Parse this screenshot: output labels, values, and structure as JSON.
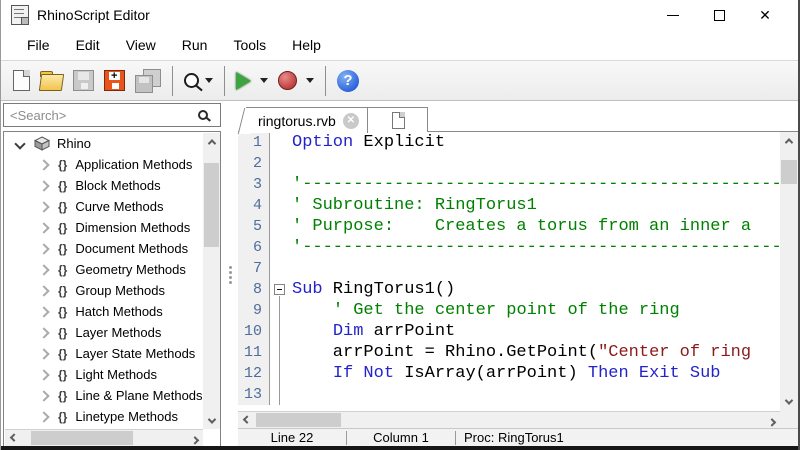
{
  "window": {
    "title": "RhinoScript Editor"
  },
  "menu_bar": {
    "items": [
      "File",
      "Edit",
      "View",
      "Run",
      "Tools",
      "Help"
    ]
  },
  "toolbar": {
    "buttons": [
      "new-file",
      "open-file",
      "save",
      "save-incremental",
      "save-all",
      "search",
      "run-script",
      "break-script",
      "help"
    ]
  },
  "sidebar": {
    "search_placeholder": "<Search>",
    "tree": {
      "root_label": "Rhino",
      "items": [
        "Application Methods",
        "Block Methods",
        "Curve Methods",
        "Dimension Methods",
        "Document Methods",
        "Geometry Methods",
        "Group Methods",
        "Hatch Methods",
        "Layer Methods",
        "Layer State Methods",
        "Light Methods",
        "Line & Plane Methods",
        "Linetype Methods"
      ]
    }
  },
  "editor": {
    "tabs": [
      {
        "label": "ringtorus.rvb"
      },
      {
        "label": ""
      }
    ],
    "lines": [
      {
        "num": "1",
        "fold": "",
        "tokens": [
          {
            "c": "kw",
            "t": "Option"
          },
          {
            "c": "pl",
            "t": " Explicit"
          }
        ]
      },
      {
        "num": "2",
        "fold": "",
        "tokens": []
      },
      {
        "num": "3",
        "fold": "",
        "tokens": [
          {
            "c": "cm",
            "t": "'------------------------------------------------------------"
          }
        ]
      },
      {
        "num": "4",
        "fold": "",
        "tokens": [
          {
            "c": "cm",
            "t": "' Subroutine: RingTorus1"
          }
        ]
      },
      {
        "num": "5",
        "fold": "",
        "tokens": [
          {
            "c": "cm",
            "t": "' Purpose:    Creates a torus from an inner a"
          }
        ]
      },
      {
        "num": "6",
        "fold": "",
        "tokens": [
          {
            "c": "cm",
            "t": "'------------------------------------------------------------"
          }
        ]
      },
      {
        "num": "7",
        "fold": "",
        "tokens": []
      },
      {
        "num": "8",
        "fold": "minus",
        "tokens": [
          {
            "c": "kw",
            "t": "Sub"
          },
          {
            "c": "pl",
            "t": " RingTorus1()"
          }
        ]
      },
      {
        "num": "9",
        "fold": "line",
        "tokens": [
          {
            "c": "pl",
            "t": "    "
          },
          {
            "c": "cm",
            "t": "' Get the center point of the ring"
          }
        ]
      },
      {
        "num": "10",
        "fold": "line",
        "tokens": [
          {
            "c": "pl",
            "t": "    "
          },
          {
            "c": "kw",
            "t": "Dim"
          },
          {
            "c": "pl",
            "t": " arrPoint"
          }
        ]
      },
      {
        "num": "11",
        "fold": "line",
        "tokens": [
          {
            "c": "pl",
            "t": "    arrPoint = Rhino.GetPoint("
          },
          {
            "c": "str",
            "t": "\"Center of ring"
          }
        ]
      },
      {
        "num": "12",
        "fold": "line",
        "tokens": [
          {
            "c": "pl",
            "t": "    "
          },
          {
            "c": "kw",
            "t": "If"
          },
          {
            "c": "pl",
            "t": " "
          },
          {
            "c": "kw",
            "t": "Not"
          },
          {
            "c": "pl",
            "t": " IsArray(arrPoint) "
          },
          {
            "c": "kw",
            "t": "Then"
          },
          {
            "c": "pl",
            "t": " "
          },
          {
            "c": "kw",
            "t": "Exit"
          },
          {
            "c": "pl",
            "t": " "
          },
          {
            "c": "kw",
            "t": "Sub"
          }
        ]
      },
      {
        "num": "13",
        "fold": "line",
        "tokens": []
      }
    ]
  },
  "status_bar": {
    "line": "Line 22",
    "column": "Column 1",
    "proc": "Proc: RingTorus1"
  },
  "colors": {
    "keyword": "#2323cc",
    "comment": "#008000",
    "string": "#8b1a1a",
    "line_number": "#4e6d9c",
    "folder": "#f2c44d",
    "run": "#3fa33f",
    "record": "#c04040",
    "help": "#2b5fd9",
    "save_highlight": "#e8541c"
  }
}
